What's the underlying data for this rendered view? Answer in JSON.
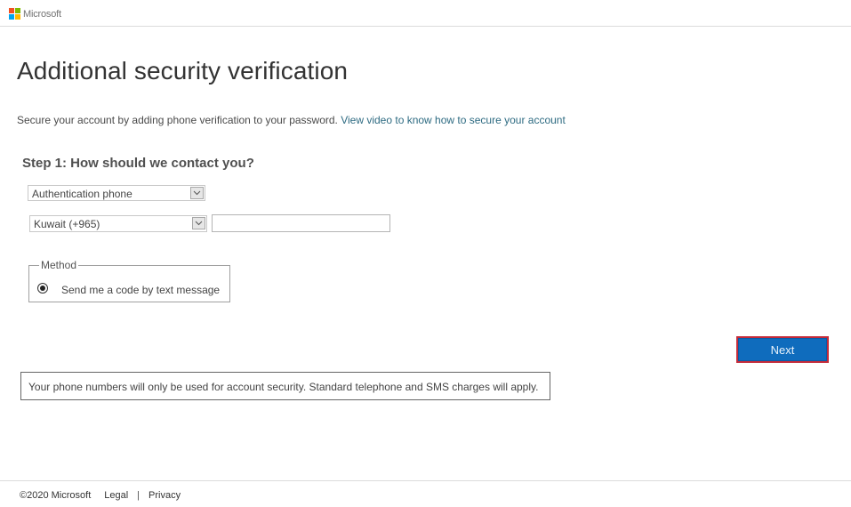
{
  "header": {
    "brand": "Microsoft",
    "logo_colors": [
      "#f25022",
      "#7fba00",
      "#00a4ef",
      "#ffb900"
    ]
  },
  "main": {
    "title": "Additional security verification",
    "intro_text": "Secure your account by adding phone verification to your password. ",
    "intro_link": "View video to know how to secure your account",
    "step_heading": "Step 1: How should we contact you?",
    "contact_method_select": {
      "value": "Authentication phone",
      "icon": "chevron-down-icon"
    },
    "country_select": {
      "value": "Kuwait (+965)",
      "icon": "chevron-down-icon"
    },
    "phone_input": {
      "value": "",
      "placeholder": ""
    },
    "method": {
      "legend": "Method",
      "option_label": "Send me a code by text message",
      "selected": true
    },
    "next_button": "Next",
    "notice": "Your phone numbers will only be used for account security. Standard telephone and SMS charges will apply."
  },
  "footer": {
    "copyright": "©2020 Microsoft",
    "links": [
      "Legal",
      "Privacy"
    ],
    "separator": "|"
  },
  "colors": {
    "accent": "#0f6cbd",
    "highlight_border": "#c42b3a",
    "link": "#2e6b82"
  }
}
